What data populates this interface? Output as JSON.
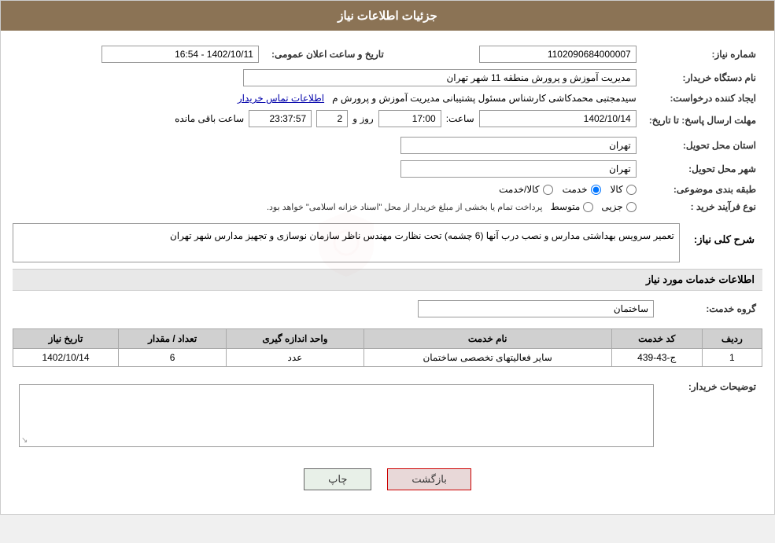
{
  "header": {
    "title": "جزئیات اطلاعات نیاز"
  },
  "fields": {
    "شماره_نیاز_label": "شماره نیاز:",
    "شماره_نیاز_value": "1102090684000007",
    "تاریخ_label": "تاریخ و ساعت اعلان عمومی:",
    "تاریخ_value": "1402/10/11 - 16:54",
    "نام_دستگاه_label": "نام دستگاه خریدار:",
    "نام_دستگاه_value": "مدیریت آموزش و پرورش منطقه 11 شهر تهران",
    "ایجاد_label": "ایجاد کننده درخواست:",
    "ایجاد_value": "سیدمجتبی محمدکاشی کارشناس مسئول پشتیبانی مدیریت آموزش و پرورش م",
    "ایجاد_link": "اطلاعات تماس خریدار",
    "مهلت_label": "مهلت ارسال پاسخ: تا تاریخ:",
    "مهلت_date": "1402/10/14",
    "مهلت_ساعت_label": "ساعت:",
    "مهلت_ساعت_value": "17:00",
    "مهلت_روز_label": "روز و",
    "مهلت_روز_value": "2",
    "مهلت_باقی_label": "ساعت باقی مانده",
    "مهلت_باقی_value": "23:37:57",
    "استان_label": "استان محل تحویل:",
    "استان_value": "تهران",
    "شهر_label": "شهر محل تحویل:",
    "شهر_value": "تهران",
    "طبقه_label": "طبقه بندی موضوعی:",
    "طبقه_options": [
      "کالا",
      "خدمت",
      "کالا/خدمت"
    ],
    "طبقه_selected": "خدمت",
    "نوع_فرآیند_label": "نوع فرآیند خرید :",
    "نوع_فرآیند_options": [
      "جزیی",
      "متوسط"
    ],
    "نوع_فرآیند_note": "پرداخت تمام یا بخشی از مبلغ خریدار از محل \"اسناد خزانه اسلامی\" خواهد بود.",
    "شرح_label": "شرح کلی نیاز:",
    "شرح_value": "تعمیر سرویس بهداشتی مدارس و نصب درب آنها (6 چشمه) تحت نظارت مهندس ناظر سازمان نوسازی و تجهیز مدارس شهر تهران",
    "section_خدمات": "اطلاعات خدمات مورد نیاز",
    "گروه_label": "گروه خدمت:",
    "گروه_value": "ساختمان",
    "توضیحات_label": "توضیحات خریدار:"
  },
  "table": {
    "headers": [
      "ردیف",
      "کد خدمت",
      "نام خدمت",
      "واحد اندازه گیری",
      "تعداد / مقدار",
      "تاریخ نیاز"
    ],
    "rows": [
      {
        "ردیف": "1",
        "کد_خدمت": "ج-43-439",
        "نام_خدمت": "سایر فعالیتهای تخصصی ساختمان",
        "واحد": "عدد",
        "تعداد": "6",
        "تاریخ": "1402/10/14"
      }
    ]
  },
  "buttons": {
    "back_label": "بازگشت",
    "print_label": "چاپ"
  }
}
